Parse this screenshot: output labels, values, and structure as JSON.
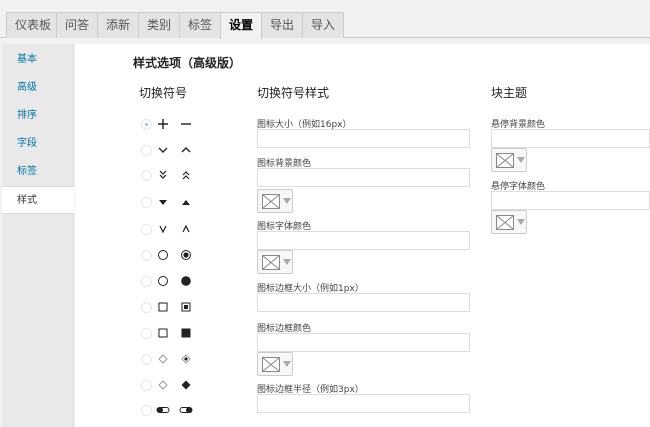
{
  "tabs": [
    {
      "label": "仪表板",
      "active": false
    },
    {
      "label": "问答",
      "active": false
    },
    {
      "label": "添新",
      "active": false
    },
    {
      "label": "类别",
      "active": false
    },
    {
      "label": "标签",
      "active": false
    },
    {
      "label": "设置",
      "active": true
    },
    {
      "label": "导出",
      "active": false
    },
    {
      "label": "导入",
      "active": false
    }
  ],
  "sidebar": {
    "items": [
      {
        "label": "基本",
        "active": false
      },
      {
        "label": "高级",
        "active": false
      },
      {
        "label": "排序",
        "active": false
      },
      {
        "label": "字段",
        "active": false
      },
      {
        "label": "标签",
        "active": false
      },
      {
        "label": "样式",
        "active": true
      }
    ]
  },
  "main": {
    "section_title": "样式选项（高级版）",
    "toggle_symbol_heading": "切换符号",
    "toggle_style_heading": "切换符号样式",
    "block_theme_heading": "块主题",
    "icon_options": [
      {
        "icons": [
          "plus-icon",
          "minus-icon"
        ],
        "selected": true
      },
      {
        "icons": [
          "chevron-down-icon",
          "chevron-up-icon"
        ],
        "selected": false
      },
      {
        "icons": [
          "double-chevron-down-icon",
          "double-chevron-up-icon"
        ],
        "selected": false
      },
      {
        "icons": [
          "triangle-down-icon",
          "triangle-up-icon"
        ],
        "selected": false
      },
      {
        "icons": [
          "thin-chevron-down-icon",
          "thin-chevron-up-icon"
        ],
        "selected": false
      },
      {
        "icons": [
          "circle-outline-icon",
          "circle-target-icon"
        ],
        "selected": false
      },
      {
        "icons": [
          "circle-outline-icon",
          "circle-filled-icon"
        ],
        "selected": false
      },
      {
        "icons": [
          "square-outline-icon",
          "square-target-icon"
        ],
        "selected": false
      },
      {
        "icons": [
          "square-outline-icon",
          "square-filled-icon"
        ],
        "selected": false
      },
      {
        "icons": [
          "diamond-outline-icon",
          "diamond-target-icon"
        ],
        "selected": false
      },
      {
        "icons": [
          "diamond-outline-icon",
          "diamond-filled-icon"
        ],
        "selected": false
      },
      {
        "icons": [
          "toggle-off-icon",
          "toggle-on-icon"
        ],
        "selected": false
      }
    ],
    "style_fields": {
      "icon_size_label": "图标大小（例如16px）",
      "icon_size_value": "",
      "icon_bg_color_label": "图标背景颜色",
      "icon_bg_color_value": "",
      "icon_font_color_label": "图标字体颜色",
      "icon_font_color_value": "",
      "icon_border_size_label": "图标边框大小（例如1px）",
      "icon_border_size_value": "",
      "icon_border_color_label": "图标边框颜色",
      "icon_border_color_value": "",
      "icon_border_radius_label": "图标边框半径（例如3px）",
      "icon_border_radius_value": ""
    },
    "block_fields": {
      "hover_bg_color_label": "悬停背景颜色",
      "hover_bg_color_value": "",
      "hover_font_color_label": "悬停字体颜色",
      "hover_font_color_value": ""
    }
  },
  "colors": {
    "link": "#0073aa",
    "tab_bg": "#e4e4e4",
    "page_bg": "#f1f1f1",
    "panel_bg": "#ffffff"
  }
}
